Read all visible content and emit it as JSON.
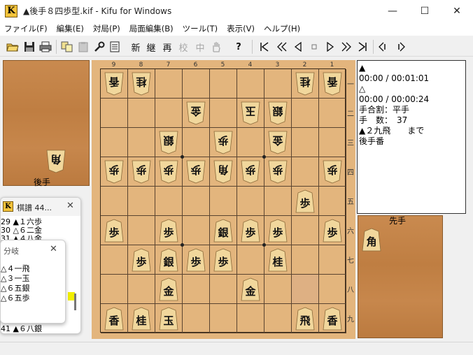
{
  "window": {
    "app_icon_letter": "K",
    "title": "▲後手８四歩型.kif - Kifu for Windows",
    "minimize": "—",
    "maximize": "☐",
    "close": "✕"
  },
  "menu": [
    "ファイル(F)",
    "編集(E)",
    "対局(P)",
    "局面編集(B)",
    "ツール(T)",
    "表示(V)",
    "ヘルプ(H)"
  ],
  "toolbar": {
    "text_buttons": [
      "新",
      "継",
      "再",
      "校",
      "中"
    ],
    "disabled": [
      "校",
      "中"
    ],
    "help": "?",
    "icons": [
      "open-folder-icon",
      "save-icon",
      "print-icon",
      "copy-icon",
      "paste-icon",
      "tools-icon",
      "list-icon",
      "hand-icon",
      "help-icon",
      "first-move-icon",
      "back-ten-icon",
      "back-one-icon",
      "stop-icon",
      "forward-one-icon",
      "forward-ten-icon",
      "last-move-icon",
      "prev-branch-icon",
      "next-branch-icon"
    ]
  },
  "board": {
    "files": [
      "9",
      "8",
      "7",
      "6",
      "5",
      "4",
      "3",
      "2",
      "1"
    ],
    "ranks": [
      "一",
      "二",
      "三",
      "四",
      "五",
      "六",
      "七",
      "八",
      "九"
    ],
    "last_move_square": {
      "file": 2,
      "rank": 8
    },
    "pieces": [
      {
        "file": 9,
        "rank": 1,
        "kanji": "香",
        "side": "gote"
      },
      {
        "file": 8,
        "rank": 1,
        "kanji": "桂",
        "side": "gote"
      },
      {
        "file": 2,
        "rank": 1,
        "kanji": "桂",
        "side": "gote"
      },
      {
        "file": 1,
        "rank": 1,
        "kanji": "香",
        "side": "gote"
      },
      {
        "file": 6,
        "rank": 2,
        "kanji": "金",
        "side": "gote"
      },
      {
        "file": 4,
        "rank": 2,
        "kanji": "玉",
        "side": "gote"
      },
      {
        "file": 3,
        "rank": 2,
        "kanji": "銀",
        "side": "gote"
      },
      {
        "file": 7,
        "rank": 3,
        "kanji": "銀",
        "side": "gote"
      },
      {
        "file": 5,
        "rank": 3,
        "kanji": "歩",
        "side": "gote"
      },
      {
        "file": 3,
        "rank": 3,
        "kanji": "金",
        "side": "gote"
      },
      {
        "file": 9,
        "rank": 4,
        "kanji": "歩",
        "side": "gote"
      },
      {
        "file": 8,
        "rank": 4,
        "kanji": "歩",
        "side": "gote"
      },
      {
        "file": 7,
        "rank": 4,
        "kanji": "歩",
        "side": "gote"
      },
      {
        "file": 6,
        "rank": 4,
        "kanji": "歩",
        "side": "gote"
      },
      {
        "file": 5,
        "rank": 4,
        "kanji": "角",
        "side": "gote"
      },
      {
        "file": 4,
        "rank": 4,
        "kanji": "歩",
        "side": "gote"
      },
      {
        "file": 3,
        "rank": 4,
        "kanji": "歩",
        "side": "gote"
      },
      {
        "file": 1,
        "rank": 4,
        "kanji": "歩",
        "side": "gote"
      },
      {
        "file": 2,
        "rank": 5,
        "kanji": "歩",
        "side": "sente"
      },
      {
        "file": 9,
        "rank": 6,
        "kanji": "歩",
        "side": "sente"
      },
      {
        "file": 7,
        "rank": 6,
        "kanji": "歩",
        "side": "sente"
      },
      {
        "file": 5,
        "rank": 6,
        "kanji": "銀",
        "side": "sente"
      },
      {
        "file": 4,
        "rank": 6,
        "kanji": "歩",
        "side": "sente"
      },
      {
        "file": 3,
        "rank": 6,
        "kanji": "歩",
        "side": "sente"
      },
      {
        "file": 1,
        "rank": 6,
        "kanji": "歩",
        "side": "sente"
      },
      {
        "file": 8,
        "rank": 7,
        "kanji": "歩",
        "side": "sente"
      },
      {
        "file": 7,
        "rank": 7,
        "kanji": "銀",
        "side": "sente"
      },
      {
        "file": 6,
        "rank": 7,
        "kanji": "歩",
        "side": "sente"
      },
      {
        "file": 5,
        "rank": 7,
        "kanji": "歩",
        "side": "sente"
      },
      {
        "file": 3,
        "rank": 7,
        "kanji": "桂",
        "side": "sente"
      },
      {
        "file": 7,
        "rank": 8,
        "kanji": "金",
        "side": "sente"
      },
      {
        "file": 4,
        "rank": 8,
        "kanji": "金",
        "side": "sente"
      },
      {
        "file": 9,
        "rank": 9,
        "kanji": "香",
        "side": "sente"
      },
      {
        "file": 8,
        "rank": 9,
        "kanji": "桂",
        "side": "sente"
      },
      {
        "file": 7,
        "rank": 9,
        "kanji": "玉",
        "side": "sente"
      },
      {
        "file": 2,
        "rank": 9,
        "kanji": "飛",
        "side": "sente"
      },
      {
        "file": 1,
        "rank": 9,
        "kanji": "香",
        "side": "sente"
      }
    ]
  },
  "gote_hand": {
    "label": "後手",
    "pieces": [
      "角"
    ]
  },
  "sente_hand": {
    "label": "先手",
    "pieces": [
      "角"
    ]
  },
  "info_lines": [
    "▲",
    "00:00 / 00:01:01",
    "△",
    "00:00 / 00:00:24",
    "手合割：平手",
    "手　数：　37",
    "▲２九飛　　まで",
    "後手番"
  ],
  "kifu_window": {
    "title": "棋譜 44...",
    "close": "✕",
    "lines": [
      "29 ▲１六歩",
      "30 △６二金",
      "31 ▲４八金",
      "41 ▲６八銀"
    ]
  },
  "branch_window": {
    "title": "分岐",
    "close": "✕",
    "lines": [
      "△４一飛",
      "△３一玉",
      "△６五銀",
      "△６五歩"
    ]
  }
}
